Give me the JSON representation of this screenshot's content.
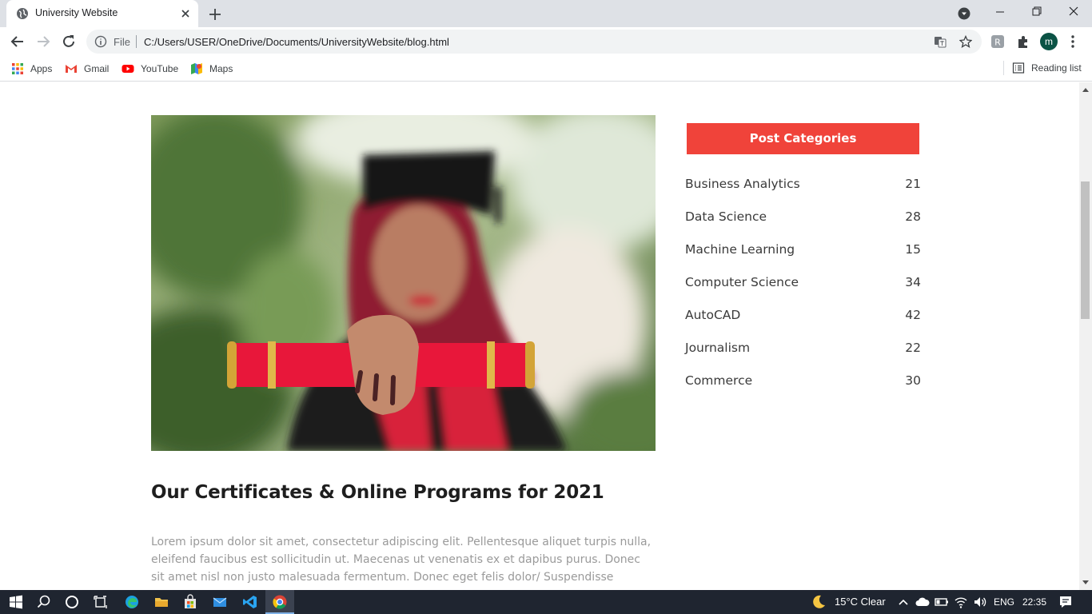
{
  "tab": {
    "title": "University Website"
  },
  "address": {
    "file_label": "File",
    "url": "C:/Users/USER/OneDrive/Documents/UniversityWebsite/blog.html"
  },
  "profile": {
    "initial": "m"
  },
  "bookmarks": {
    "items": [
      {
        "label": "Apps",
        "icon": "apps-grid-icon"
      },
      {
        "label": "Gmail",
        "icon": "gmail-icon"
      },
      {
        "label": "YouTube",
        "icon": "youtube-icon"
      },
      {
        "label": "Maps",
        "icon": "maps-icon"
      }
    ],
    "reading_list": "Reading list"
  },
  "post": {
    "title": "Our Certificates & Online Programs for 2021",
    "body": "Lorem ipsum dolor sit amet, consectetur adipiscing elit. Pellentesque aliquet turpis nulla, eleifend faucibus est sollicitudin ut. Maecenas ut venenatis ex et dapibus purus. Donec sit amet nisl non justo malesuada fermentum. Donec eget felis dolor/ Suspendisse"
  },
  "sidebar": {
    "heading": "Post Categories",
    "categories": [
      {
        "name": "Business Analytics",
        "count": "21"
      },
      {
        "name": "Data Science",
        "count": "28"
      },
      {
        "name": "Machine Learning",
        "count": "15"
      },
      {
        "name": "Computer Science",
        "count": "34"
      },
      {
        "name": "AutoCAD",
        "count": "42"
      },
      {
        "name": "Journalism",
        "count": "22"
      },
      {
        "name": "Commerce",
        "count": "30"
      }
    ]
  },
  "colors": {
    "accent": "#f0433a",
    "taskbar": "#1f2530"
  },
  "taskbar": {
    "weather": "15°C  Clear",
    "language": "ENG",
    "time": "22:35"
  }
}
